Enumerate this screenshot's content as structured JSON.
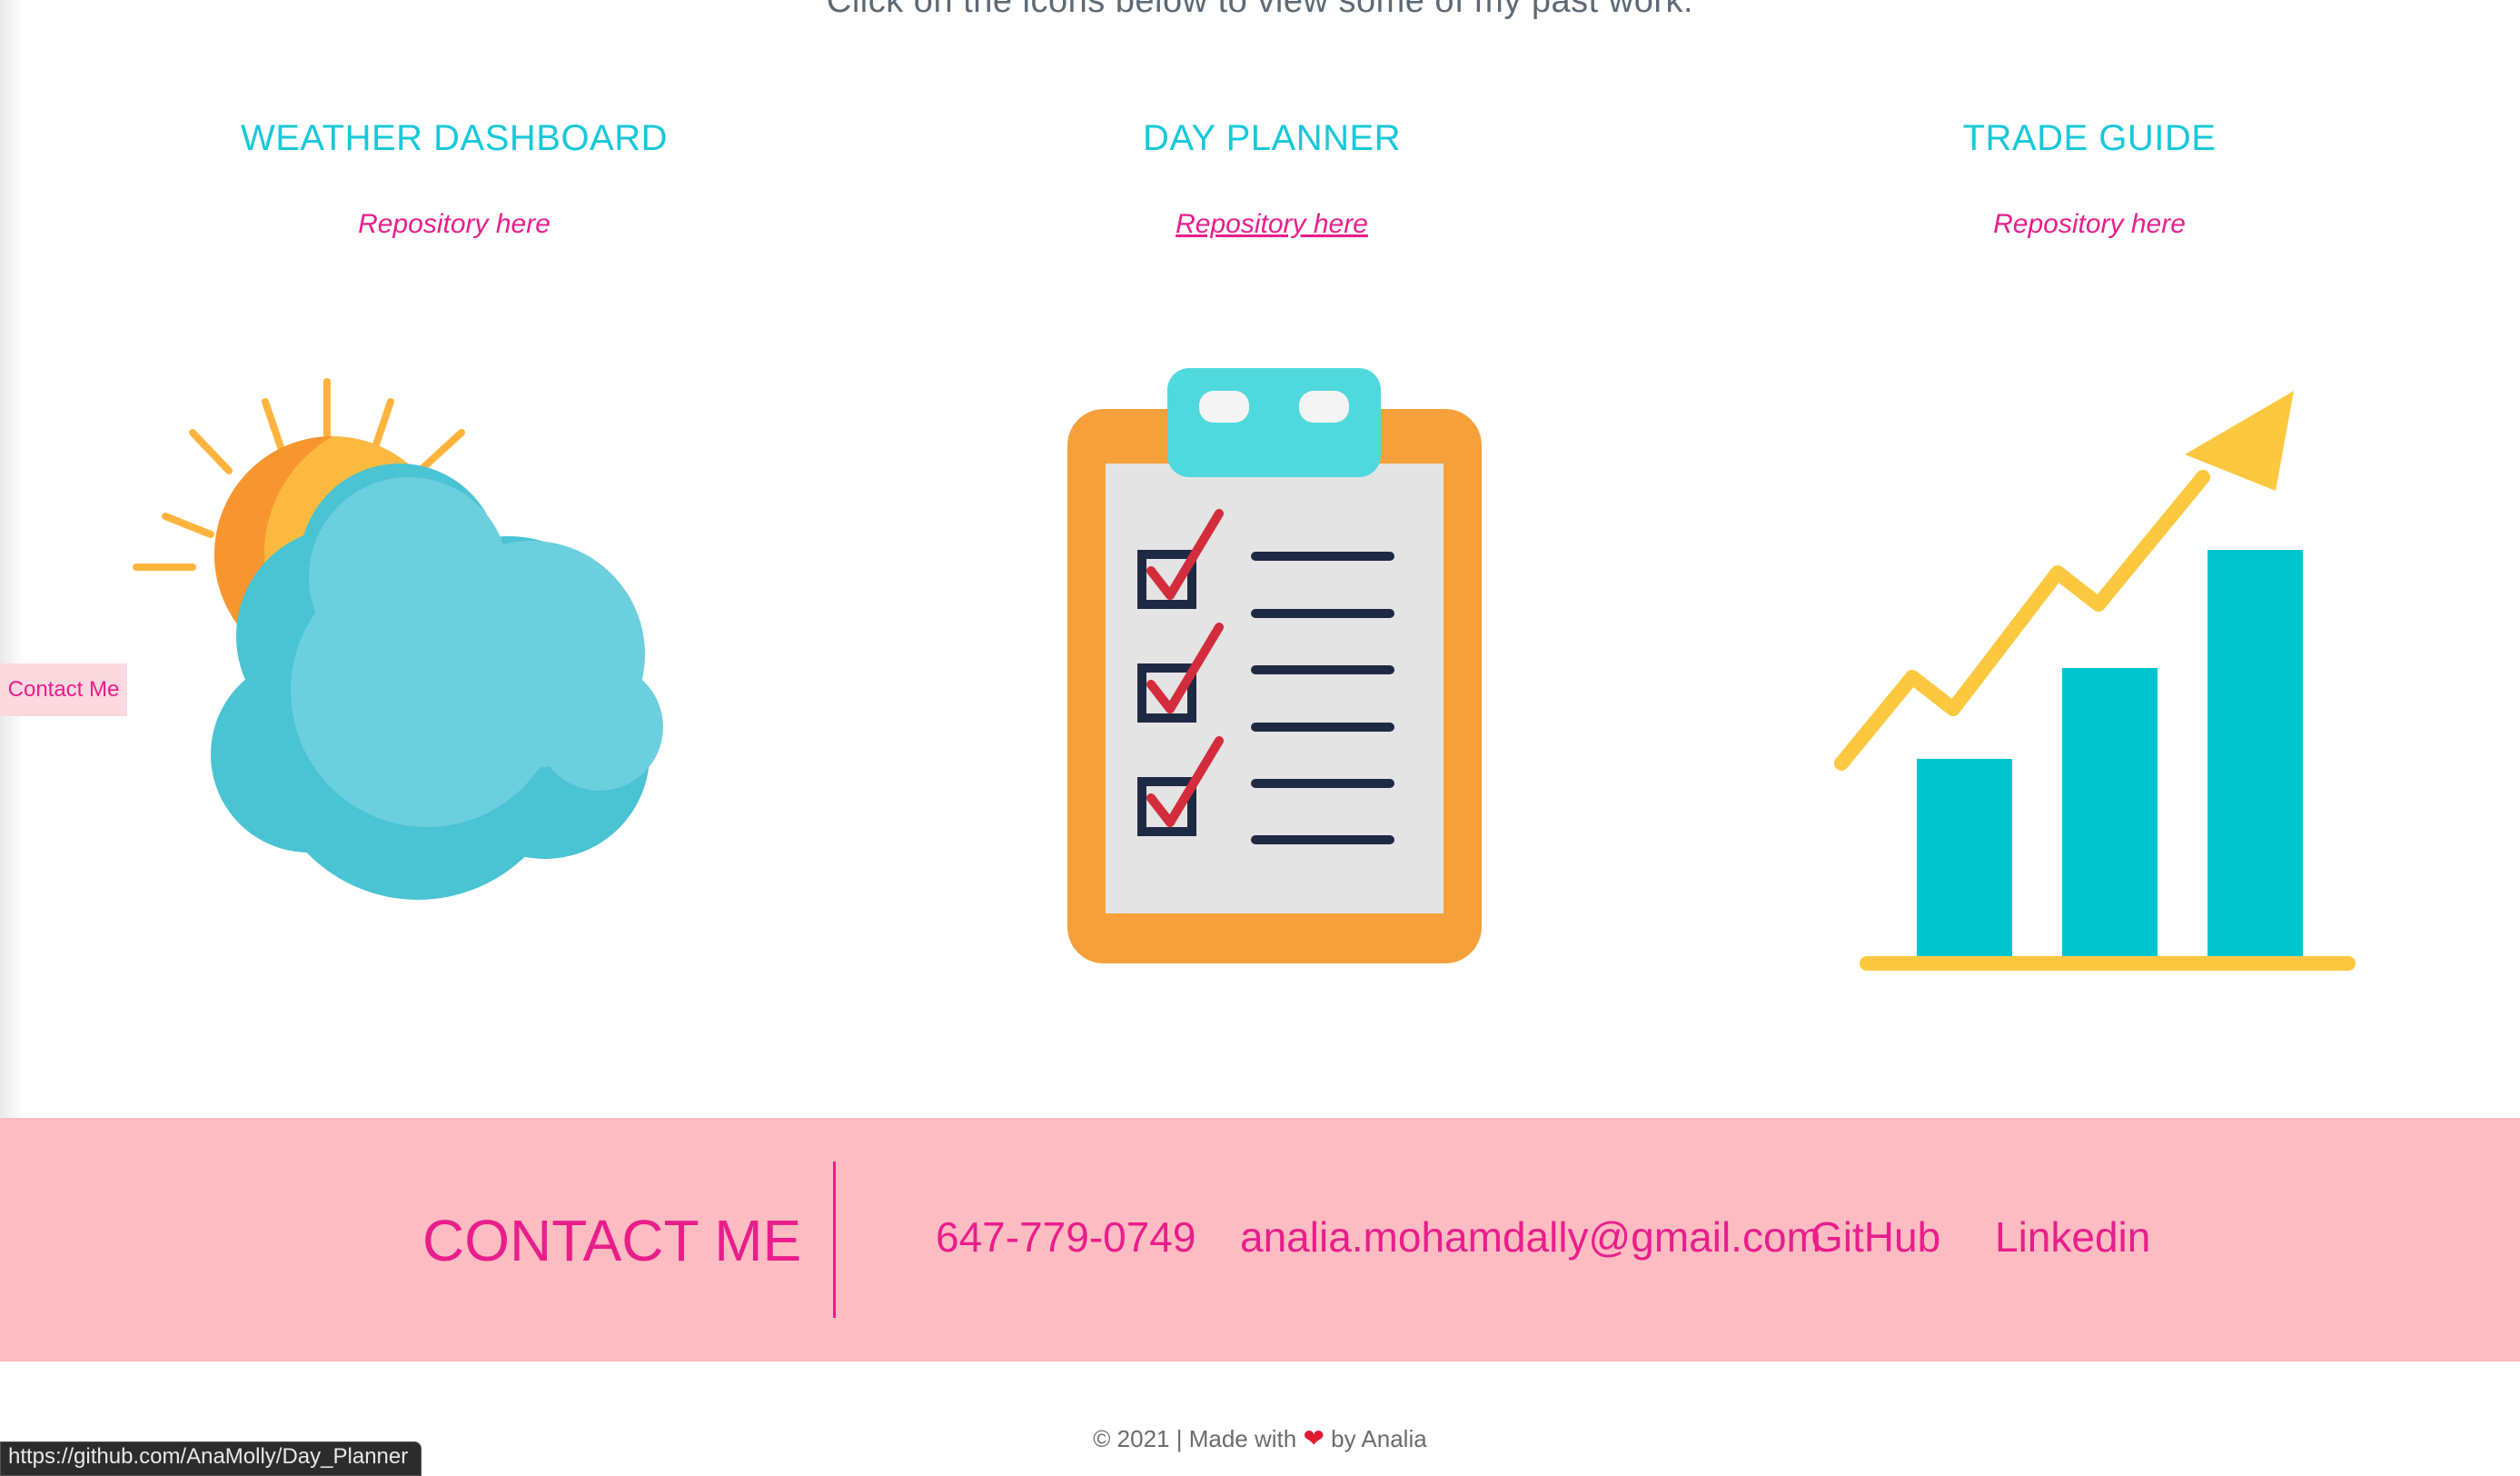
{
  "intro": "Click on the icons below to view some of my past work.",
  "projects": [
    {
      "title": "WEATHER DASHBOARD",
      "repo_label": "Repository here",
      "icon": "weather-icon"
    },
    {
      "title": "DAY PLANNER",
      "repo_label": "Repository here",
      "icon": "clipboard-checklist-icon"
    },
    {
      "title": "TRADE GUIDE",
      "repo_label": "Repository here",
      "icon": "growth-chart-icon"
    }
  ],
  "contact_tab": "Contact Me",
  "contact": {
    "heading": "CONTACT ME",
    "phone": "647-779-0749",
    "email": "analia.mohamdally@gmail.com",
    "github": "GitHub",
    "linkedin": "Linkedin"
  },
  "footer": {
    "before": "© 2021 | Made with",
    "after": "by Analia",
    "heart_icon": "heart-icon"
  },
  "status_bar": {
    "url": "https://github.com/AnaMolly/Day_Planner"
  },
  "colors": {
    "accent_pink": "#e91e8c",
    "title_cyan": "#18c8d9",
    "contact_band": "#fdbcc1"
  }
}
